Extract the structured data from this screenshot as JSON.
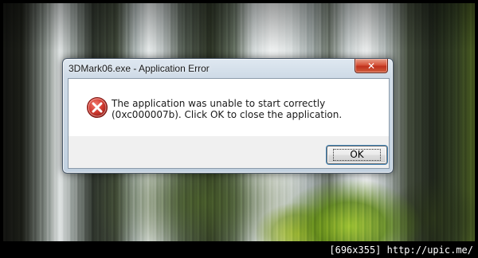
{
  "dialog": {
    "title": "3DMark06.exe - Application Error",
    "close_glyph": "✕",
    "message": "The application was unable to start correctly (0xc000007b). Click OK to close the application.",
    "ok_label": "OK",
    "icon": "error-icon"
  },
  "footer": {
    "text": "[696x355] http://upic.me/"
  },
  "colors": {
    "error_red": "#c9302c",
    "close_button_red": "#c0321d"
  }
}
